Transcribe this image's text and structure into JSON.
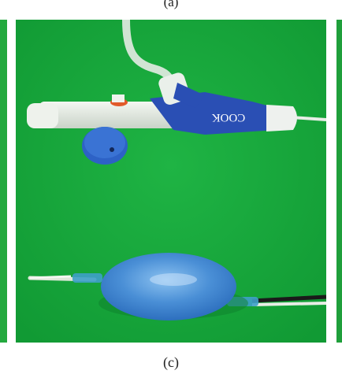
{
  "figure": {
    "top_label": "(a)",
    "bottom_label": "(c)",
    "device_brand": "COOK",
    "colors": {
      "background": "#17a63b",
      "device_blue": "#2a4fb4",
      "balloon_blue": "#4a8fd6",
      "tubing": "#e8ede6"
    }
  }
}
